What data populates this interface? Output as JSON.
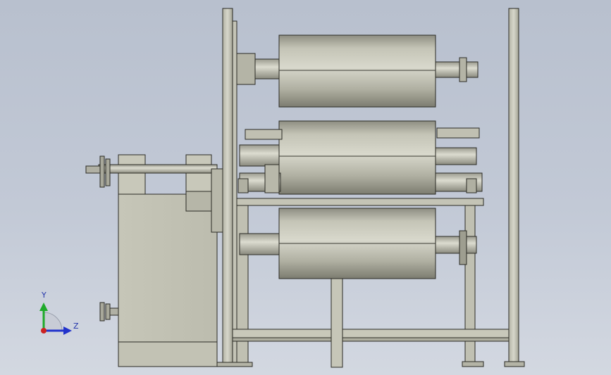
{
  "viewport": {
    "background_top": "#b8c0ce",
    "background_bottom": "#d3d8e1"
  },
  "model": {
    "colors": {
      "metal_light": "#d2d2c6",
      "metal_mid": "#b8b8aa",
      "metal_dark": "#8c8c80",
      "outline": "#2a2a24"
    }
  },
  "triad": {
    "y_label": "Y",
    "z_label": "Z",
    "y_color": "#1faa2a",
    "z_color": "#2233cc",
    "origin_color": "#cc2222"
  }
}
